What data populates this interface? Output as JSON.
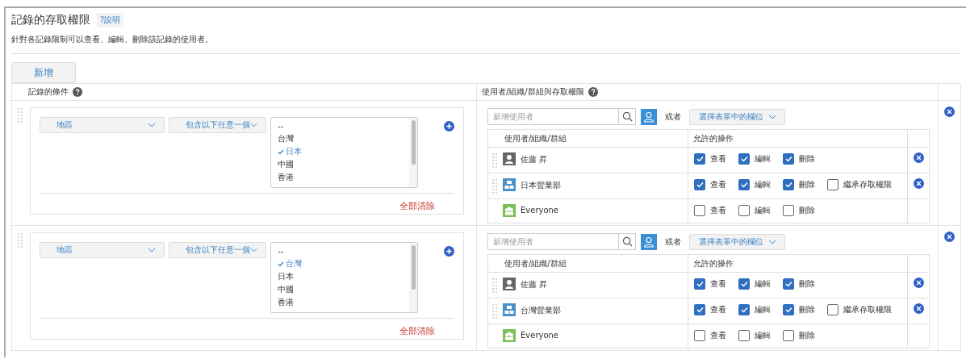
{
  "title": "記錄的存取權限",
  "help_link": "?說明",
  "description": "針對各記錄限制可以查看、編輯、刪除該記錄的使用者。",
  "add_button": "新增",
  "headers": {
    "conditions": "記錄的條件",
    "permissions": "使用者/組織/群組與存取權限"
  },
  "rules": [
    {
      "field": "地區",
      "operator": "包含以下任意一個",
      "options": [
        {
          "label": "--",
          "selected": false
        },
        {
          "label": "台灣",
          "selected": false
        },
        {
          "label": "日本",
          "selected": true
        },
        {
          "label": "中國",
          "selected": false
        },
        {
          "label": "香港",
          "selected": false
        }
      ],
      "clear_all": "全部清除",
      "search": {
        "placeholder": "新增使用者"
      },
      "or_label": "或者",
      "field_select": "選擇表單中的欄位",
      "columns": [
        "使用者/組織/群組",
        "允許的操作"
      ],
      "entries": [
        {
          "kind": "user",
          "name": "佐藤 昇",
          "removable": true,
          "permissions": [
            {
              "label": "查看",
              "checked": true
            },
            {
              "label": "編輯",
              "checked": true
            },
            {
              "label": "刪除",
              "checked": true
            }
          ]
        },
        {
          "kind": "org",
          "name": "日本營業部",
          "removable": true,
          "permissions": [
            {
              "label": "查看",
              "checked": true
            },
            {
              "label": "編輯",
              "checked": true
            },
            {
              "label": "刪除",
              "checked": true
            },
            {
              "label": "繼承存取權限",
              "checked": false
            }
          ]
        },
        {
          "kind": "group",
          "name": "Everyone",
          "removable": false,
          "permissions": [
            {
              "label": "查看",
              "checked": false
            },
            {
              "label": "編輯",
              "checked": false
            },
            {
              "label": "刪除",
              "checked": false
            }
          ]
        }
      ]
    },
    {
      "field": "地區",
      "operator": "包含以下任意一個",
      "options": [
        {
          "label": "--",
          "selected": false
        },
        {
          "label": "台灣",
          "selected": true
        },
        {
          "label": "日本",
          "selected": false
        },
        {
          "label": "中國",
          "selected": false
        },
        {
          "label": "香港",
          "selected": false
        }
      ],
      "clear_all": "全部清除",
      "search": {
        "placeholder": "新增使用者"
      },
      "or_label": "或者",
      "field_select": "選擇表單中的欄位",
      "columns": [
        "使用者/組織/群組",
        "允許的操作"
      ],
      "entries": [
        {
          "kind": "user",
          "name": "佐藤 昇",
          "removable": true,
          "permissions": [
            {
              "label": "查看",
              "checked": true
            },
            {
              "label": "編輯",
              "checked": true
            },
            {
              "label": "刪除",
              "checked": true
            }
          ]
        },
        {
          "kind": "org",
          "name": "台灣營業部",
          "removable": true,
          "permissions": [
            {
              "label": "查看",
              "checked": true
            },
            {
              "label": "編輯",
              "checked": true
            },
            {
              "label": "刪除",
              "checked": true
            },
            {
              "label": "繼承存取權限",
              "checked": false
            }
          ]
        },
        {
          "kind": "group",
          "name": "Everyone",
          "removable": false,
          "permissions": [
            {
              "label": "查看",
              "checked": false
            },
            {
              "label": "編輯",
              "checked": false
            },
            {
              "label": "刪除",
              "checked": false
            }
          ]
        }
      ]
    }
  ]
}
